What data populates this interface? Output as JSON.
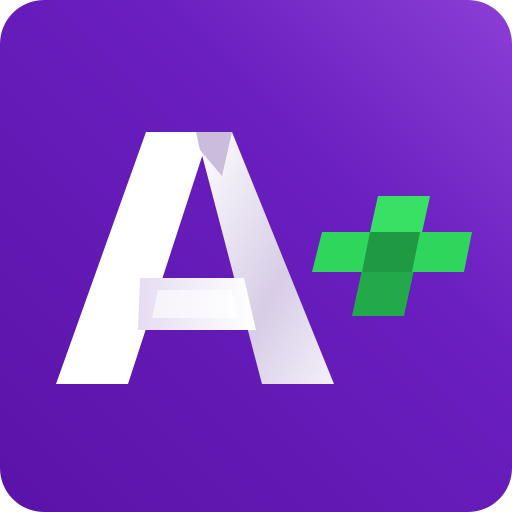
{
  "icon": {
    "name": "a-plus-app-icon",
    "glyph_letter": "A",
    "glyph_symbol": "+",
    "colors": {
      "background_start": "#8b3fd6",
      "background_end": "#5a13a8",
      "letter_light": "#ffffff",
      "letter_shade": "#d7cde6",
      "plus_primary": "#2ed65b",
      "plus_secondary": "#22a94a"
    }
  }
}
